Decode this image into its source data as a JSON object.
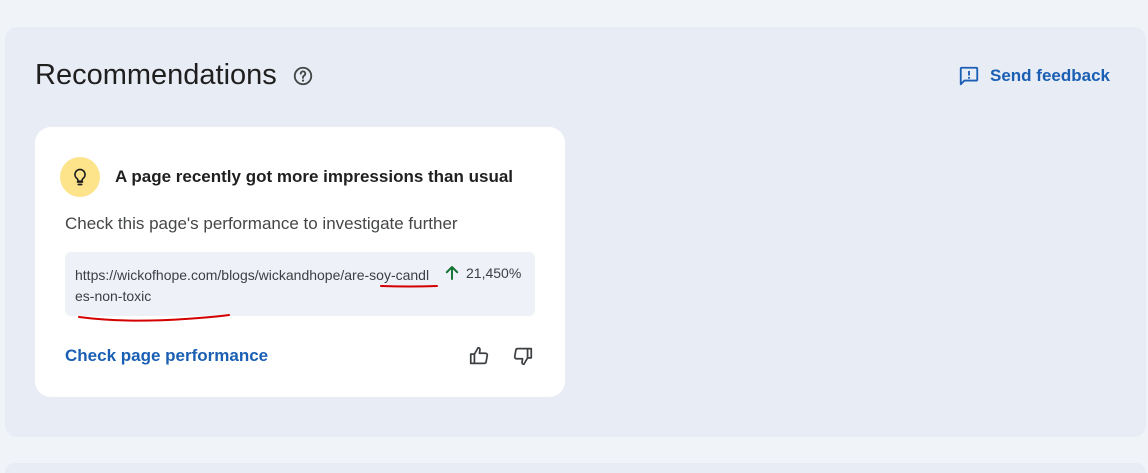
{
  "header": {
    "title": "Recommendations",
    "help_icon": "help-circle-icon",
    "feedback_label": "Send feedback",
    "feedback_icon": "feedback-icon"
  },
  "card": {
    "icon": "lightbulb-icon",
    "title": "A page recently got more impressions than usual",
    "subtitle": "Check this page's performance to investigate further",
    "url": "https://wickofhope.com/blogs/wickandhope/are-soy-candles-non-toxic",
    "change_icon": "arrow-up-icon",
    "change_value": "21,450%",
    "link_label": "Check page performance",
    "thumbs_up_icon": "thumbs-up-icon",
    "thumbs_down_icon": "thumbs-down-icon"
  },
  "colors": {
    "accent": "#1a5fb4",
    "positive": "#137333",
    "bulb_bg": "#fde38a",
    "annotation": "#d40000"
  }
}
